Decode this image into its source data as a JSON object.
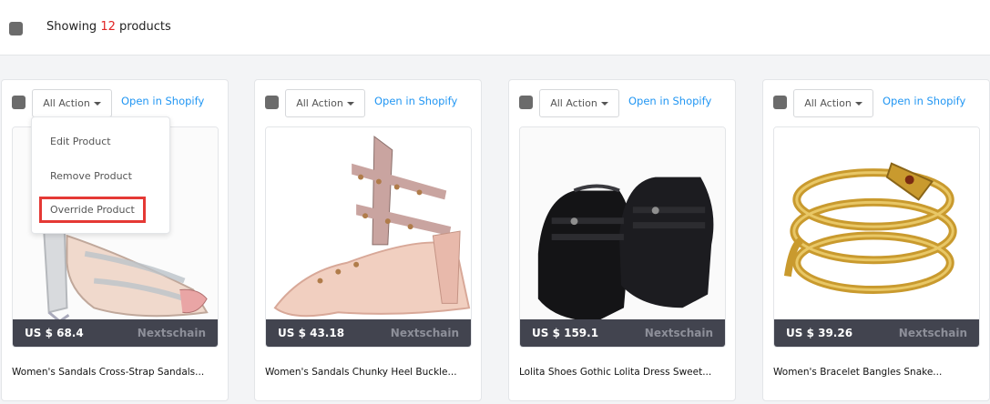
{
  "header": {
    "showing_prefix": "Showing",
    "count": "12",
    "showing_suffix": "products"
  },
  "actions": {
    "label": "All Action",
    "open_label": "Open in Shopify"
  },
  "dropdown": {
    "items": [
      "Edit Product",
      "Remove Product",
      "Override Product"
    ],
    "highlighted_index": 2,
    "highlight_color": "#e53935"
  },
  "products": [
    {
      "price": "US $ 68.4",
      "vendor": "Nextschain",
      "title": "Women's Sandals Cross-Strap Sandals..."
    },
    {
      "price": "US $ 43.18",
      "vendor": "Nextschain",
      "title": "Women's Sandals Chunky Heel Buckle..."
    },
    {
      "price": "US $ 159.1",
      "vendor": "Nextschain",
      "title": "Lolita Shoes Gothic Lolita Dress Sweet..."
    },
    {
      "price": "US $ 39.26",
      "vendor": "Nextschain",
      "title": "Women's Bracelet Bangles Snake..."
    }
  ],
  "colors": {
    "link": "#2196f3",
    "count": "#e02424",
    "price_bar": "#42444f"
  }
}
